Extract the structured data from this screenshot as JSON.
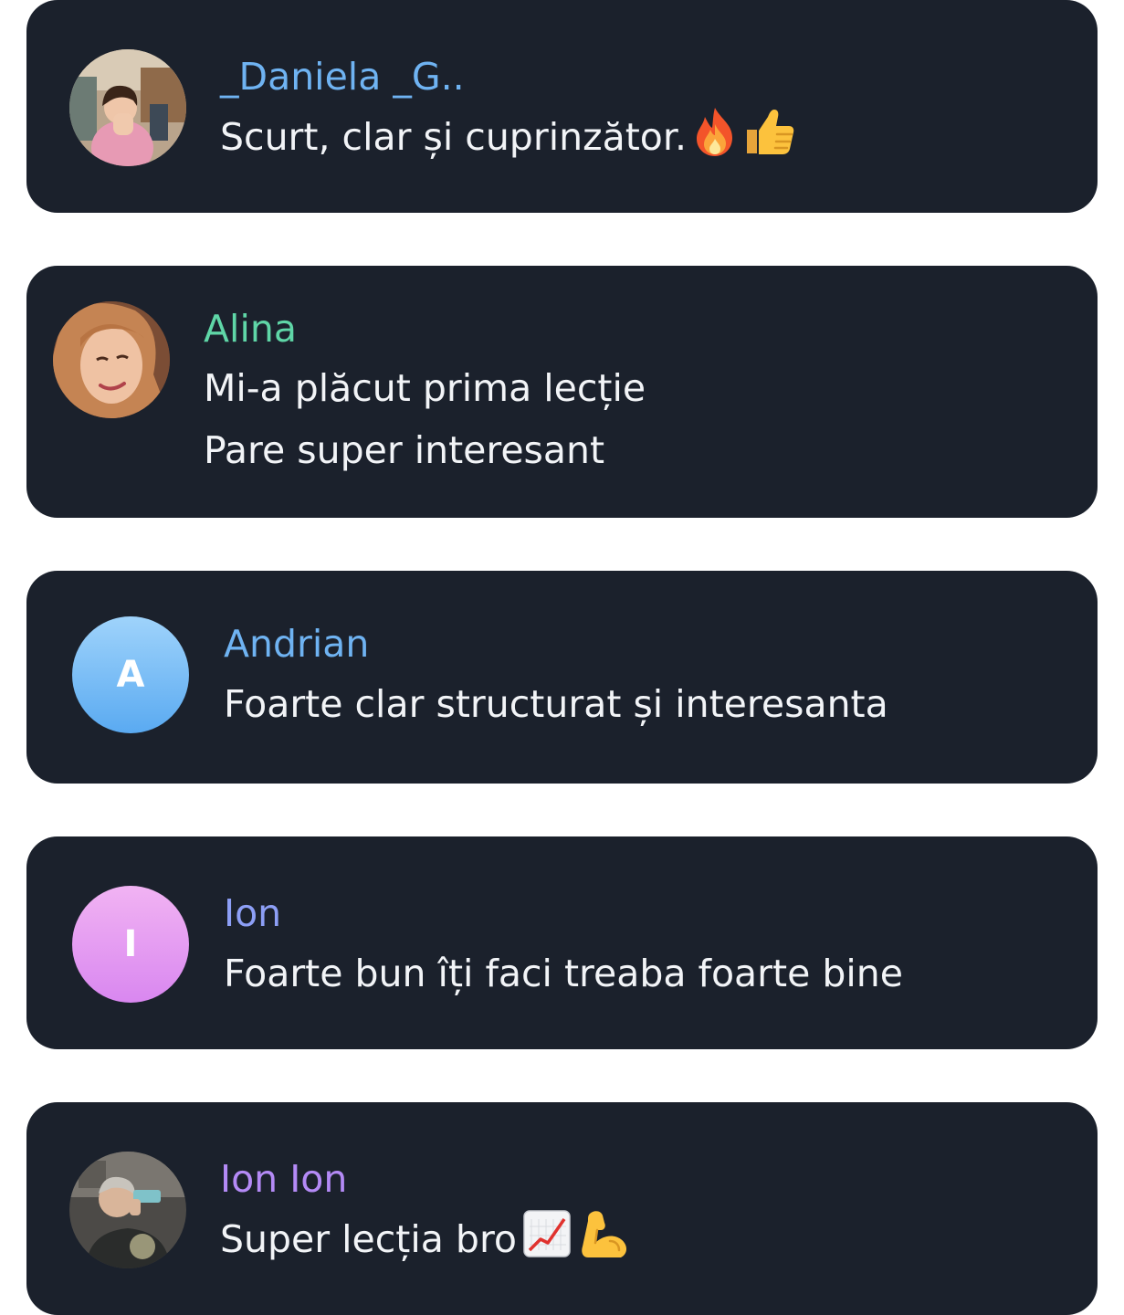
{
  "comments": [
    {
      "name": "_Daniela _G..",
      "name_color": "#6fb3f2",
      "avatar": {
        "kind": "photo",
        "icon": "user-photo-daniela"
      },
      "lines": [
        "Scurt, clar și cuprinzător."
      ],
      "emojis": [
        "fire-emoji",
        "thumbs-up-emoji"
      ]
    },
    {
      "name": "Alina",
      "name_color": "#5fd6a7",
      "avatar": {
        "kind": "photo",
        "icon": "user-photo-alina"
      },
      "lines": [
        "Mi-a plăcut prima lecție",
        "Pare super interesant"
      ]
    },
    {
      "name": "Andrian",
      "name_color": "#6fb3f2",
      "avatar": {
        "kind": "letter",
        "letter": "A",
        "gradient": [
          "#9fd3fb",
          "#5aaaf1"
        ]
      },
      "lines": [
        "Foarte clar structurat și interesanta"
      ]
    },
    {
      "name": "Ion",
      "name_color": "#8d9ff6",
      "avatar": {
        "kind": "letter",
        "letter": "I",
        "gradient": [
          "#f1b3f3",
          "#d987f0"
        ]
      },
      "lines": [
        "Foarte bun îți faci treaba foarte bine"
      ]
    },
    {
      "name": "Ion Ion",
      "name_color": "#b48af6",
      "avatar": {
        "kind": "photo",
        "icon": "user-photo-ion-ion"
      },
      "lines": [
        "Super lecția bro"
      ],
      "emojis": [
        "chart-increasing-emoji",
        "flexed-biceps-emoji"
      ]
    }
  ]
}
